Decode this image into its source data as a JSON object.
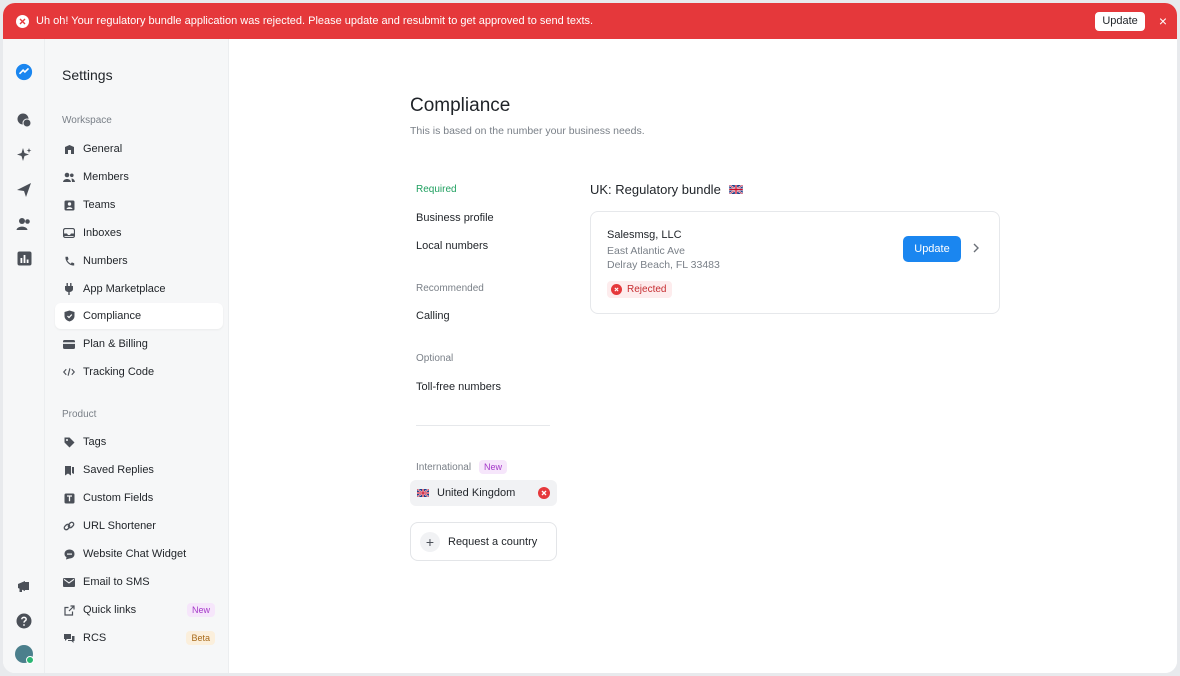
{
  "banner": {
    "message": "Uh oh! Your regulatory bundle application was rejected. Please update and resubmit to get approved to send texts.",
    "update_label": "Update",
    "close_label": "×",
    "color": "#e5383b"
  },
  "rail": {
    "icons": [
      "logo-icon",
      "chat-icon",
      "sparkle-icon",
      "send-icon",
      "contacts-icon",
      "reports-icon",
      "megaphone-icon",
      "help-icon",
      "avatar"
    ]
  },
  "sidebar": {
    "title": "Settings",
    "workspace_label": "Workspace",
    "product_label": "Product",
    "workspace_items": [
      {
        "label": "General",
        "icon": "building-icon"
      },
      {
        "label": "Members",
        "icon": "members-icon"
      },
      {
        "label": "Teams",
        "icon": "teams-icon"
      },
      {
        "label": "Inboxes",
        "icon": "inbox-icon"
      },
      {
        "label": "Numbers",
        "icon": "phone-icon"
      },
      {
        "label": "App Marketplace",
        "icon": "plug-icon"
      },
      {
        "label": "Compliance",
        "icon": "shield-icon",
        "active": true
      },
      {
        "label": "Plan & Billing",
        "icon": "card-icon"
      },
      {
        "label": "Tracking Code",
        "icon": "code-icon"
      }
    ],
    "product_items": [
      {
        "label": "Tags",
        "icon": "tag-icon"
      },
      {
        "label": "Saved Replies",
        "icon": "bookmark-icon"
      },
      {
        "label": "Custom Fields",
        "icon": "field-icon"
      },
      {
        "label": "URL Shortener",
        "icon": "link-icon"
      },
      {
        "label": "Website Chat Widget",
        "icon": "chat-bubble-icon"
      },
      {
        "label": "Email to SMS",
        "icon": "mail-icon"
      },
      {
        "label": "Quick links",
        "icon": "external-link-icon",
        "badge": "New"
      },
      {
        "label": "RCS",
        "icon": "rcs-icon",
        "badge": "Beta"
      }
    ]
  },
  "main": {
    "title": "Compliance",
    "subtitle": "This is based on the number your business needs.",
    "required_label": "Required",
    "business_profile": "Business profile",
    "local_numbers": "Local numbers",
    "recommended_label": "Recommended",
    "calling": "Calling",
    "optional_label": "Optional",
    "toll_free": "Toll-free numbers",
    "international_label": "International",
    "international_badge": "New",
    "country": "United Kingdom",
    "request_country": "Request a country",
    "bundle_title": "UK: Regulatory bundle",
    "card": {
      "name": "Salesmsg, LLC",
      "address_line1": "East Atlantic Ave",
      "address_line2": "Delray Beach, FL 33483",
      "status": "Rejected",
      "update_label": "Update"
    },
    "accent": "#1a86f0",
    "status_color": "#20a060"
  }
}
